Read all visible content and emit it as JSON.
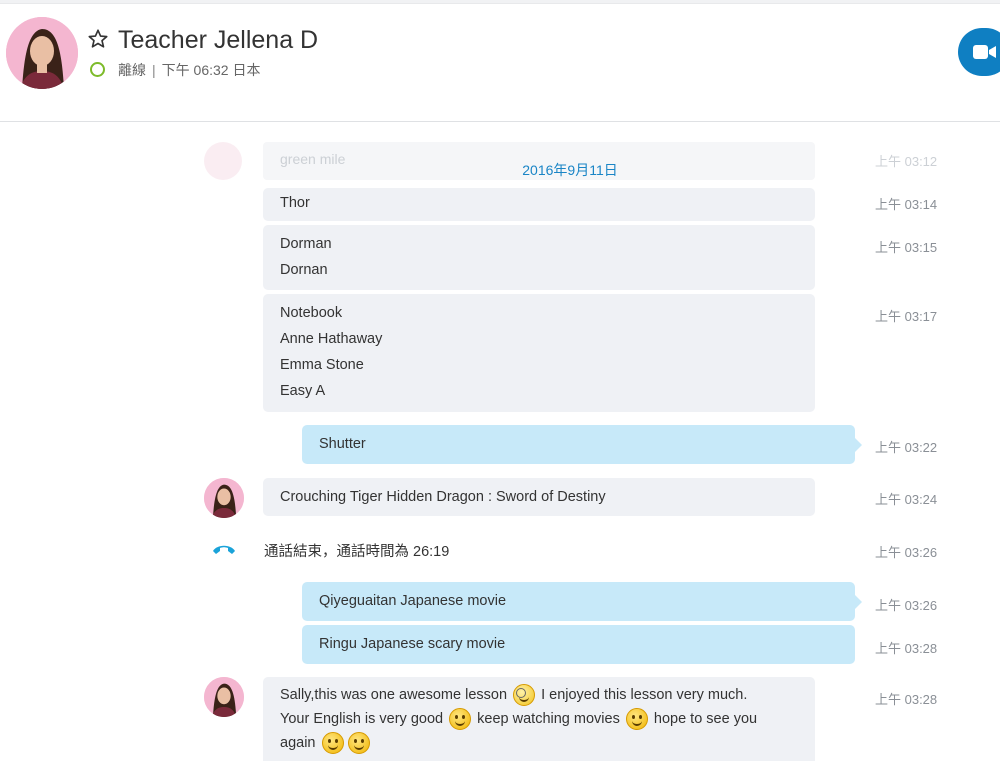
{
  "header": {
    "contact_name": "Teacher Jellena D",
    "status": "離線",
    "local_time": "下午 06:32 日本",
    "separator": "|"
  },
  "chat": {
    "ghost_message": {
      "text": "green mile",
      "time": "上午 03:12"
    },
    "date_separator": "2016年9月11日",
    "messages": [
      {
        "lines": [
          "Thor"
        ],
        "time": "上午 03:14"
      },
      {
        "lines": [
          "Dorman",
          "Dornan"
        ],
        "time": "上午 03:15"
      },
      {
        "lines": [
          "Notebook",
          "Anne Hathaway",
          "Emma Stone",
          "Easy A"
        ],
        "time": "上午 03:17"
      },
      {
        "lines": [
          "Shutter"
        ],
        "time": "上午 03:22"
      },
      {
        "lines": [
          "Crouching Tiger Hidden Dragon : Sword of Destiny"
        ],
        "time": "上午 03:24"
      },
      {
        "lines": [
          "Qiyeguaitan Japanese movie"
        ],
        "time": "上午 03:26"
      },
      {
        "lines": [
          "Ringu Japanese scary movie"
        ],
        "time": "上午 03:28"
      }
    ],
    "call_ended": {
      "text": "通話結束，通話時間為 26:19",
      "time": "上午 03:26"
    },
    "last_message": {
      "part1": "Sally,this was one awesome lesson",
      "part2": " I enjoyed this lesson very much.",
      "part3": "Your English is very good",
      "part4": " keep watching movies",
      "part5": " hope to see you",
      "part6": "again",
      "time": "上午 03:28"
    }
  },
  "colors": {
    "accent": "#0f7fc2",
    "date": "#1a85c6",
    "status_online_ring": "#7dbb2a",
    "incoming_bubble": "#eff1f5",
    "outgoing_bubble": "#c7e9f9",
    "call_icon": "#1aa3d9"
  },
  "icons": [
    "star-icon",
    "status-icon",
    "video-call-icon",
    "call-ended-icon",
    "smile-emoticon",
    "nerd-emoticon"
  ]
}
